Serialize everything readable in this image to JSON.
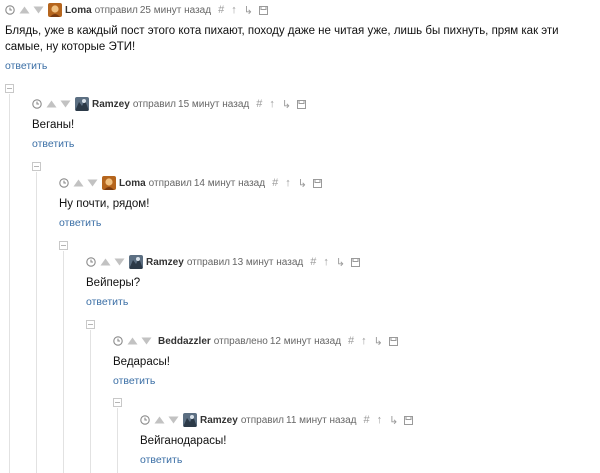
{
  "comments": [
    {
      "author": "Loma",
      "verb": "отправил",
      "time": "25 минут назад",
      "text": "Блядь, уже в каждый пост этого кота пихают, походу даже не читая уже, лишь бы пихнуть, прям как эти самые, ну которые ЭТИ!",
      "reply": "ответить",
      "avatar": "avatar-loma"
    },
    {
      "author": "Ramzey",
      "verb": "отправил",
      "time": "15 минут назад",
      "text": "Веганы!",
      "reply": "ответить",
      "avatar": "avatar-ramzey"
    },
    {
      "author": "Loma",
      "verb": "отправил",
      "time": "14 минут назад",
      "text": "Ну почти, рядом!",
      "reply": "ответить",
      "avatar": "avatar-loma"
    },
    {
      "author": "Ramzey",
      "verb": "отправил",
      "time": "13 минут назад",
      "text": "Вейперы?",
      "reply": "ответить",
      "avatar": "avatar-ramzey"
    },
    {
      "author": "Beddazzler",
      "verb": "отправлено",
      "time": "12 минут назад",
      "text": "Ведарасы!",
      "reply": "ответить",
      "avatar": "none"
    },
    {
      "author": "Ramzey",
      "verb": "отправил",
      "time": "11 минут назад",
      "text": "Вейганодарасы!",
      "reply": "ответить",
      "avatar": "avatar-ramzey"
    }
  ],
  "actions": {
    "hash": "#",
    "parent": "↑",
    "thread": "↳"
  },
  "icons": [
    "clock-icon",
    "vote-down-icon",
    "vote-up-icon",
    "hash-link-icon",
    "parent-arrow-icon",
    "thread-arrow-icon",
    "save-icon",
    "collapse-icon"
  ],
  "colors": {
    "link": "#3a6ea5",
    "meta": "#555555",
    "icon": "#9a9a9a",
    "thread_line": "#e2e2e2"
  }
}
